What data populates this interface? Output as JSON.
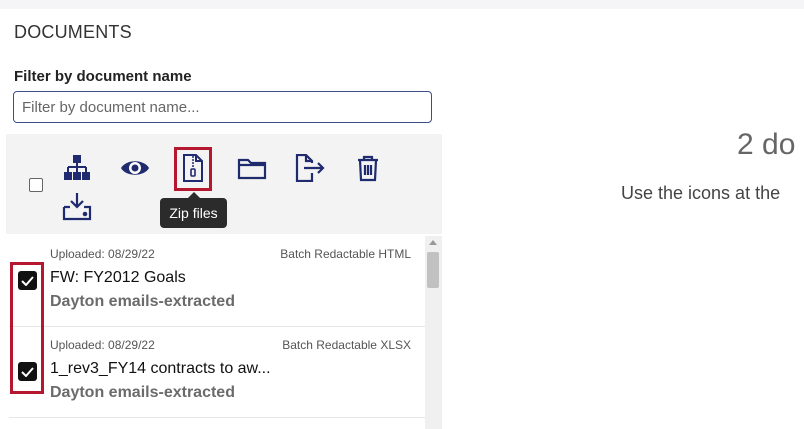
{
  "documents_panel": {
    "title": "DOCUMENTS",
    "filter": {
      "label": "Filter by document name",
      "placeholder": "Filter by document name...",
      "value": ""
    },
    "toolbar": {
      "icons": [
        "hierarchy-icon",
        "eye-icon",
        "zip-file-icon",
        "folder-icon",
        "export-icon",
        "trash-icon",
        "download-icon"
      ],
      "tooltip": "Zip files"
    },
    "documents": [
      {
        "uploaded": "Uploaded: 08/29/22",
        "type": "Batch Redactable HTML",
        "name": "FW: FY2012 Goals",
        "source": "Dayton emails-extracted",
        "checked": true
      },
      {
        "uploaded": "Uploaded: 08/29/22",
        "type": "Batch Redactable XLSX",
        "name": "1_rev3_FY14 contracts to aw...",
        "source": "Dayton emails-extracted",
        "checked": true
      }
    ]
  },
  "right_panel": {
    "count_text": "2 do",
    "hint_text": "Use the icons at the"
  },
  "colors": {
    "icon": "#1f2b6e",
    "highlight": "#b5172f",
    "tooltip_bg": "#2b2b2b"
  }
}
